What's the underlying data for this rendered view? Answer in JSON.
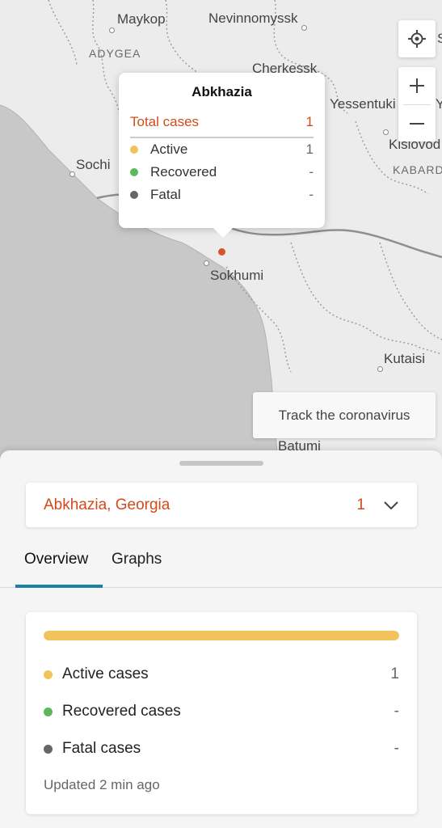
{
  "map": {
    "cities": [
      {
        "name": "Maykop",
        "kind": "city"
      },
      {
        "name": "Nevinnomyssk",
        "kind": "city"
      },
      {
        "name": "ADYGEA",
        "kind": "region"
      },
      {
        "name": "Cherkessk",
        "kind": "city"
      },
      {
        "name": "Yessentuki",
        "kind": "city"
      },
      {
        "name": "Kislovod",
        "kind": "city"
      },
      {
        "name": "KABARD",
        "kind": "region"
      },
      {
        "name": "Sochi",
        "kind": "city"
      },
      {
        "name": "Sokhumi",
        "kind": "city"
      },
      {
        "name": "Kutaisi",
        "kind": "city"
      },
      {
        "name": "Batumi",
        "kind": "city"
      },
      {
        "name": "S",
        "kind": "city"
      },
      {
        "name": "Y",
        "kind": "city"
      }
    ],
    "controls": {
      "locate_icon": "crosshair-icon",
      "zoom_in_icon": "plus-icon",
      "zoom_out_icon": "minus-icon"
    },
    "track_button": "Track the coronavirus"
  },
  "tooltip": {
    "title": "Abkhazia",
    "total_label": "Total cases",
    "total_value": "1",
    "rows": [
      {
        "label": "Active",
        "value": "1",
        "color": "#f2c35c"
      },
      {
        "label": "Recovered",
        "value": "-",
        "color": "#5cb85c"
      },
      {
        "label": "Fatal",
        "value": "-",
        "color": "#666666"
      }
    ]
  },
  "sheet": {
    "location": {
      "name": "Abkhazia, Georgia",
      "count": "1",
      "chevron_icon": "chevron-down-icon"
    },
    "tabs": [
      {
        "label": "Overview",
        "active": true
      },
      {
        "label": "Graphs",
        "active": false
      }
    ],
    "stats": {
      "bar_active_fraction": 1.0,
      "rows": [
        {
          "label": "Active cases",
          "value": "1",
          "color": "#f2c35c"
        },
        {
          "label": "Recovered cases",
          "value": "-",
          "color": "#5cb85c"
        },
        {
          "label": "Fatal cases",
          "value": "-",
          "color": "#666666"
        }
      ],
      "updated": "Updated 2 min ago"
    }
  },
  "colors": {
    "accent": "#d24a1c",
    "tab_underline": "#1f7fa4",
    "active": "#f2c35c",
    "recovered": "#5cb85c",
    "fatal": "#666666"
  }
}
